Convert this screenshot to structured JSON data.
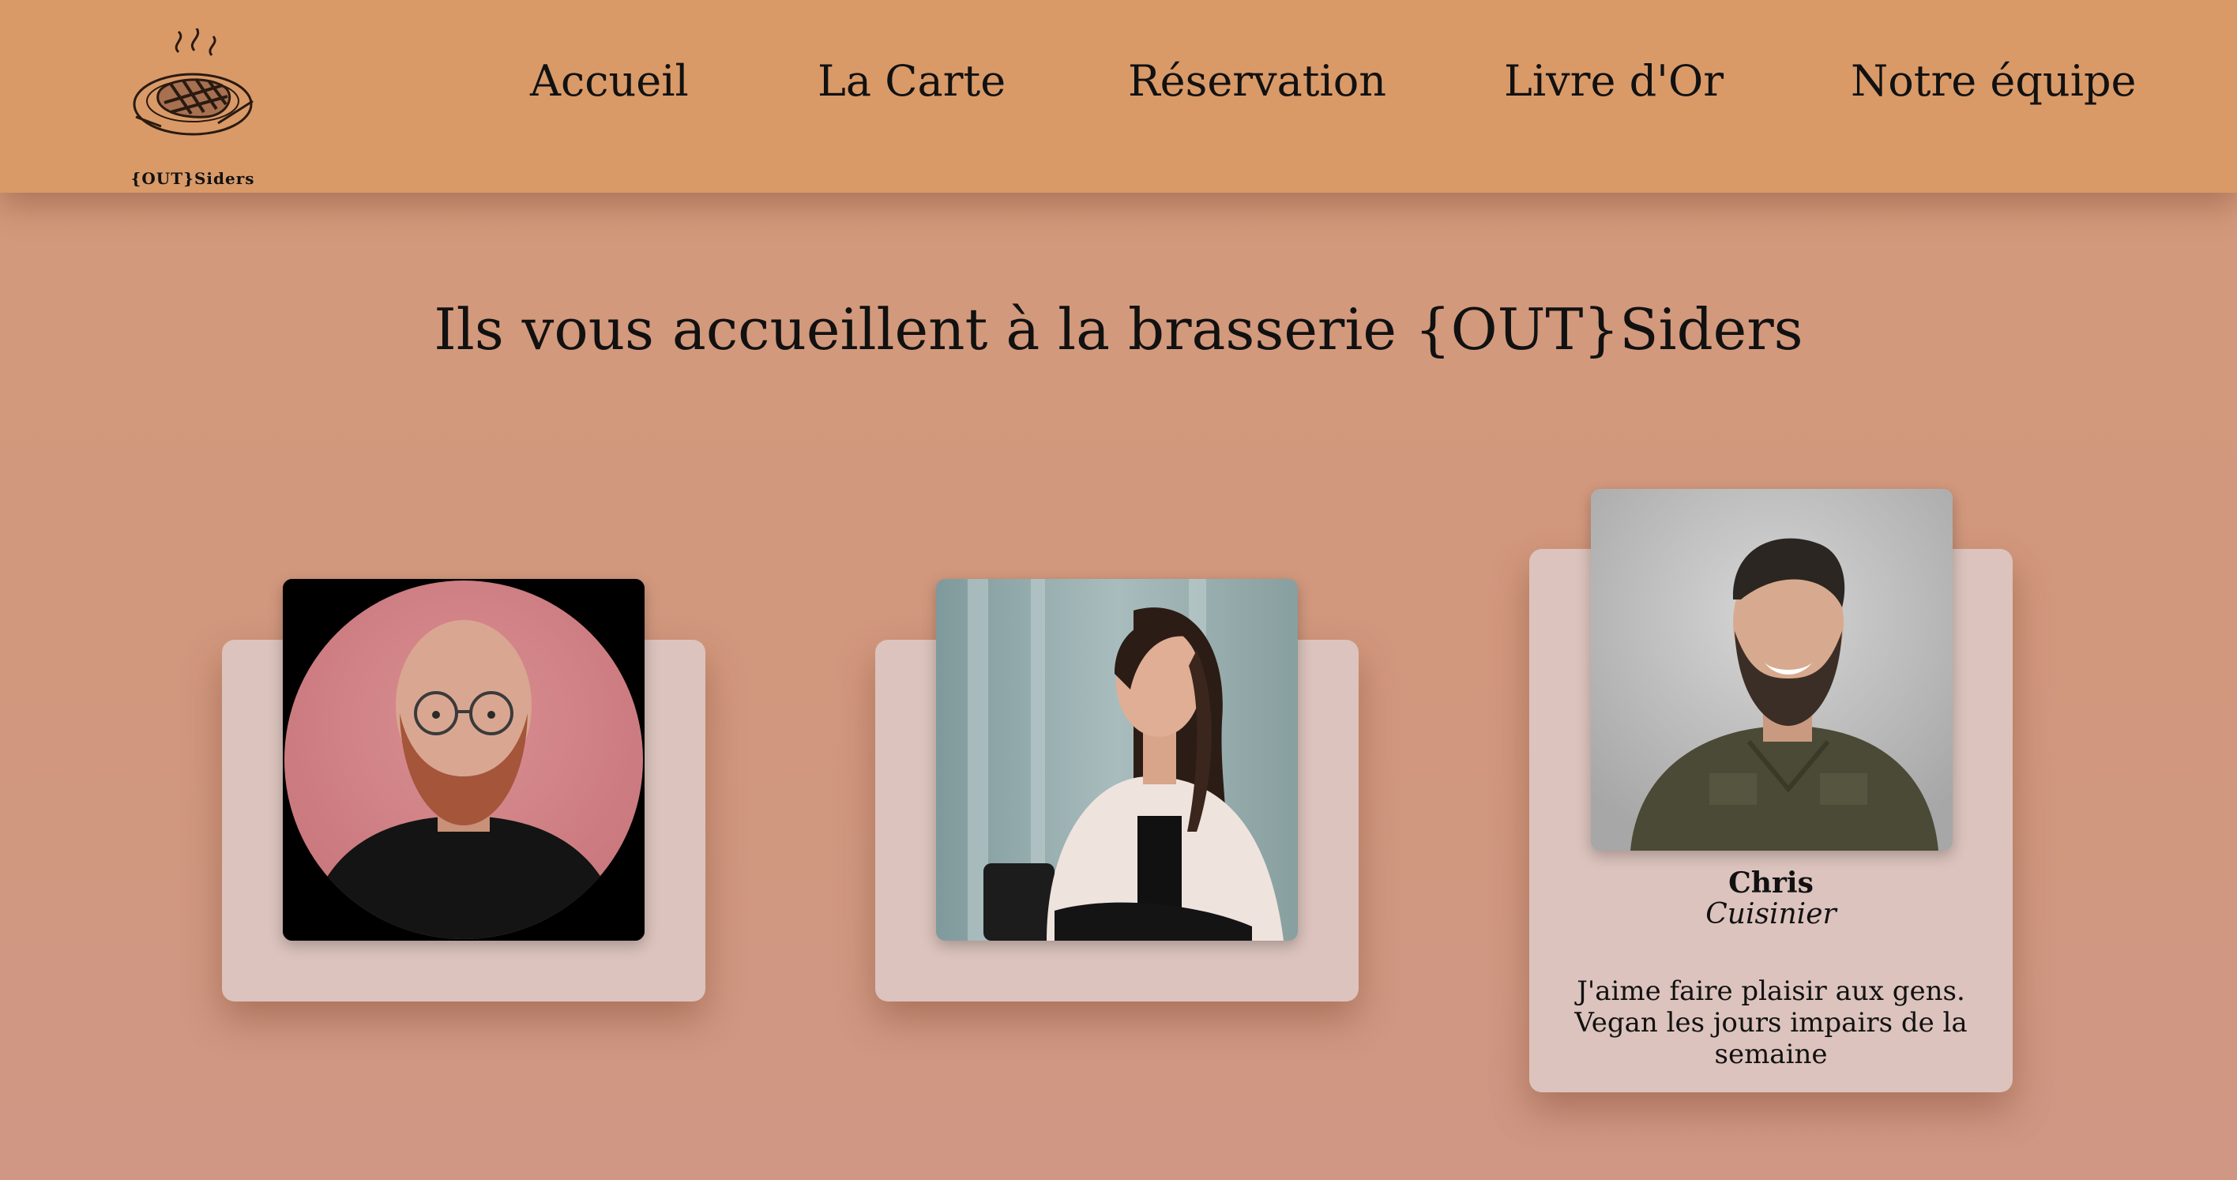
{
  "header": {
    "logo_text": "{OUT}Siders",
    "nav": [
      {
        "label": "Accueil"
      },
      {
        "label": "La Carte"
      },
      {
        "label": "Réservation"
      },
      {
        "label": "Livre d'Or"
      },
      {
        "label": "Notre équipe"
      }
    ]
  },
  "main": {
    "title": "Ils vous accueillent à la brasserie {OUT}Siders"
  },
  "team": [
    {
      "photo_icon": "portrait-bald-man-glasses"
    },
    {
      "photo_icon": "portrait-woman-white-blazer"
    },
    {
      "photo_icon": "portrait-smiling-bearded-man",
      "name": "Chris",
      "role": "Cuisinier",
      "bio": "J'aime faire plaisir aux gens. Vegan les jours impairs de la semaine"
    }
  ],
  "colors": {
    "header_bg": "#d99a68",
    "page_bg": "#d2987e",
    "card_bg": "#dcc3bd",
    "text": "#111111"
  }
}
